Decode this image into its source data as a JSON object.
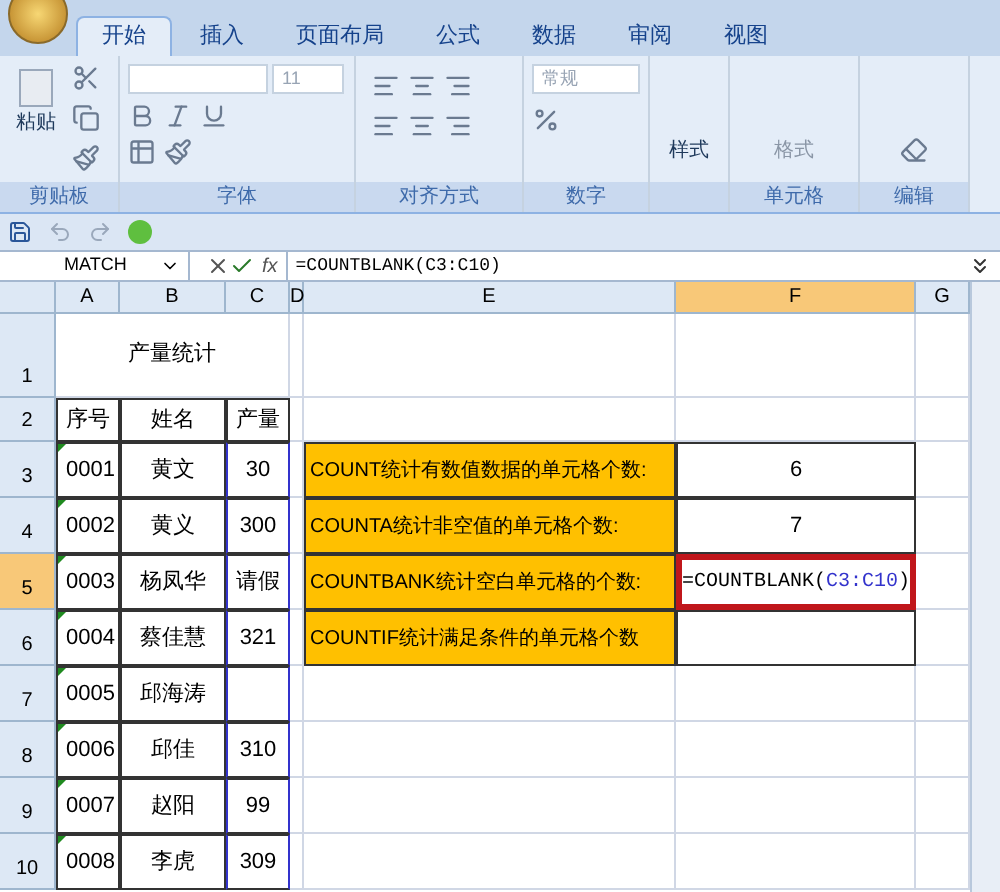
{
  "ribbon": {
    "tabs": [
      {
        "label": "开始",
        "selected": true
      },
      {
        "label": "插入",
        "selected": false
      },
      {
        "label": "页面布局",
        "selected": false
      },
      {
        "label": "公式",
        "selected": false
      },
      {
        "label": "数据",
        "selected": false
      },
      {
        "label": "审阅",
        "selected": false
      },
      {
        "label": "视图",
        "selected": false
      }
    ],
    "groups": [
      {
        "kind": "clipboard",
        "label": "剪贴板",
        "button": "粘贴"
      },
      {
        "kind": "font",
        "label": "字体",
        "value": "11"
      },
      {
        "kind": "align",
        "label": "对齐方式"
      },
      {
        "kind": "number",
        "label": "数字",
        "value": "常规"
      },
      {
        "kind": "styles",
        "button": "样式"
      },
      {
        "kind": "cells",
        "label": "单元格",
        "button": "格式"
      },
      {
        "kind": "editing",
        "label": "编辑"
      }
    ]
  },
  "formula_bar": {
    "name_box": "MATCH",
    "function_label": "fx",
    "formula": "=COUNTBLANK(C3:C10)"
  },
  "sheet": {
    "columns": [
      {
        "label": "A",
        "selected": false
      },
      {
        "label": "B",
        "selected": false
      },
      {
        "label": "C",
        "selected": false
      },
      {
        "label": "D",
        "selected": false
      },
      {
        "label": "E",
        "selected": false
      },
      {
        "label": "F",
        "selected": true
      },
      {
        "label": "G",
        "selected": false
      }
    ],
    "rows": [
      {
        "label": "1",
        "selected": false,
        "kind": "title",
        "title": "产量统计"
      },
      {
        "label": "2",
        "selected": false,
        "kind": "header",
        "cells": [
          "序号",
          "姓名",
          "产量"
        ]
      },
      {
        "label": "3",
        "selected": false,
        "kind": "data",
        "cells": [
          "0001",
          "黄文",
          "30"
        ],
        "e": {
          "text": "COUNT统计有数值数据的单元格个数:",
          "color": "#ffc000"
        },
        "f": {
          "text": "6"
        }
      },
      {
        "label": "4",
        "selected": false,
        "kind": "data",
        "cells": [
          "0002",
          "黄义",
          "300"
        ],
        "e": {
          "text": "COUNTA统计非空值的单元格个数:",
          "color": "#ffc000"
        },
        "f": {
          "text": "7"
        }
      },
      {
        "label": "5",
        "selected": true,
        "kind": "data",
        "cells": [
          "0003",
          "杨凤华",
          "请假"
        ],
        "e": {
          "text": "COUNTBANK统计空白单元格的个数:",
          "color": "#ffc000"
        },
        "f": {
          "editing": true,
          "before": "=COUNTBLANK(",
          "ref": "C3:C10",
          "after": ")"
        }
      },
      {
        "label": "6",
        "selected": false,
        "kind": "data",
        "cells": [
          "0004",
          "蔡佳慧",
          "321"
        ],
        "e": {
          "text": "COUNTIF统计满足条件的单元格个数",
          "color": "#ffc000"
        },
        "f": {}
      },
      {
        "label": "7",
        "selected": false,
        "kind": "data",
        "cells": [
          "0005",
          "邱海涛",
          ""
        ]
      },
      {
        "label": "8",
        "selected": false,
        "kind": "data",
        "cells": [
          "0006",
          "邱佳",
          "310"
        ]
      },
      {
        "label": "9",
        "selected": false,
        "kind": "data",
        "cells": [
          "0007",
          "赵阳",
          "99"
        ]
      },
      {
        "label": "10",
        "selected": false,
        "kind": "data",
        "cells": [
          "0008",
          "李虎",
          "309"
        ]
      }
    ]
  }
}
